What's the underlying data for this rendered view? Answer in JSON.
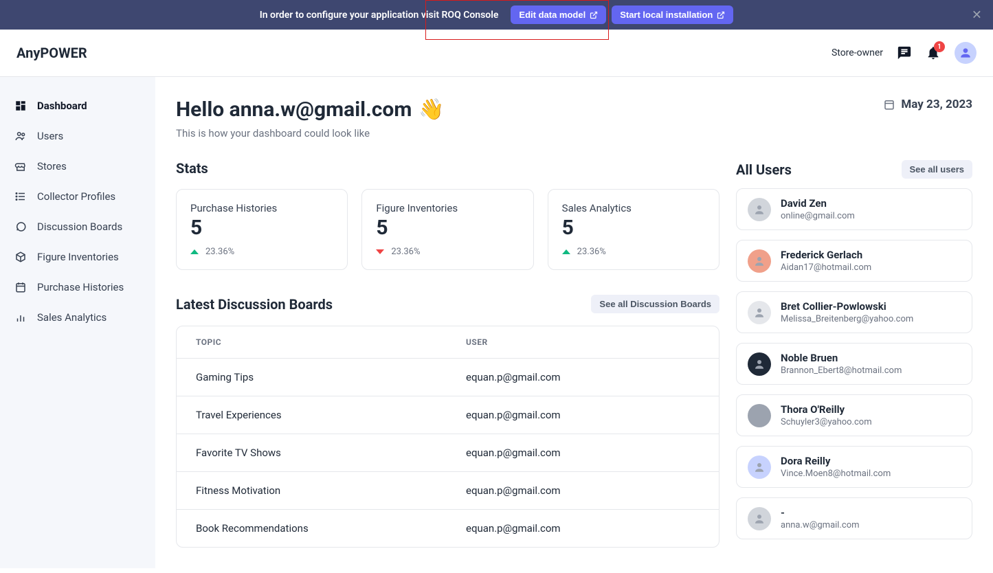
{
  "banner": {
    "text": "In order to configure your application visit ROQ Console",
    "editBtn": "Edit data model",
    "startBtn": "Start local installation"
  },
  "app": {
    "name": "AnyPOWER",
    "role": "Store-owner",
    "notificationCount": "1"
  },
  "sidebar": {
    "items": [
      {
        "label": "Dashboard"
      },
      {
        "label": "Users"
      },
      {
        "label": "Stores"
      },
      {
        "label": "Collector Profiles"
      },
      {
        "label": "Discussion Boards"
      },
      {
        "label": "Figure Inventories"
      },
      {
        "label": "Purchase Histories"
      },
      {
        "label": "Sales Analytics"
      }
    ]
  },
  "hello": {
    "greeting": "Hello anna.w@gmail.com",
    "wave": "👋",
    "subtitle": "This is how your dashboard could look like",
    "date": "May 23, 2023"
  },
  "stats": {
    "title": "Stats",
    "cards": [
      {
        "label": "Purchase Histories",
        "value": "5",
        "change": "23.36%",
        "dir": "up"
      },
      {
        "label": "Figure Inventories",
        "value": "5",
        "change": "23.36%",
        "dir": "down"
      },
      {
        "label": "Sales Analytics",
        "value": "5",
        "change": "23.36%",
        "dir": "up"
      }
    ]
  },
  "boards": {
    "title": "Latest Discussion Boards",
    "seeAll": "See all Discussion Boards",
    "colTopic": "TOPIC",
    "colUser": "USER",
    "rows": [
      {
        "topic": "Gaming Tips",
        "user": "equan.p@gmail.com"
      },
      {
        "topic": "Travel Experiences",
        "user": "equan.p@gmail.com"
      },
      {
        "topic": "Favorite TV Shows",
        "user": "equan.p@gmail.com"
      },
      {
        "topic": "Fitness Motivation",
        "user": "equan.p@gmail.com"
      },
      {
        "topic": "Book Recommendations",
        "user": "equan.p@gmail.com"
      }
    ]
  },
  "users": {
    "title": "All Users",
    "seeAll": "See all users",
    "list": [
      {
        "name": "David Zen",
        "email": "online@gmail.com",
        "color": "#d1d5db"
      },
      {
        "name": "Frederick Gerlach",
        "email": "Aidan17@hotmail.com",
        "color": "#f0a08a"
      },
      {
        "name": "Bret Collier-Powlowski",
        "email": "Melissa_Breitenberg@yahoo.com",
        "color": "#e5e7eb"
      },
      {
        "name": "Noble Bruen",
        "email": "Brannon_Ebert8@hotmail.com",
        "color": "#1f2937"
      },
      {
        "name": "Thora O'Reilly",
        "email": "Schuyler3@yahoo.com",
        "color": "#9ca3af"
      },
      {
        "name": "Dora Reilly",
        "email": "Vince.Moen8@hotmail.com",
        "color": "#c7d2fe"
      },
      {
        "name": "-",
        "email": "anna.w@gmail.com",
        "color": "#d1d5db"
      }
    ]
  }
}
